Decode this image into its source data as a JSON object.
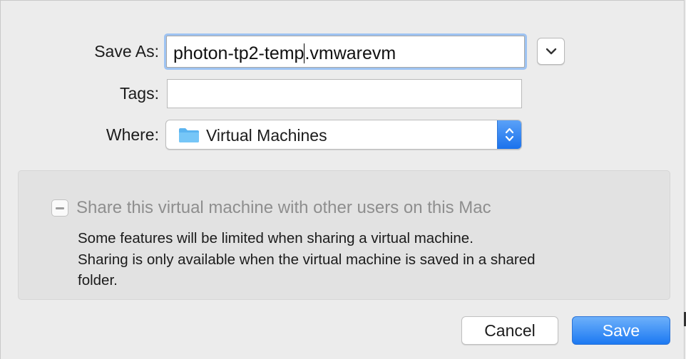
{
  "dialog": {
    "save_as_label": "Save As:",
    "filename_before_caret": "photon-tp2-temp",
    "filename_after_caret": ".vmwarevm",
    "tags_label": "Tags:",
    "tags_value": "",
    "where_label": "Where:",
    "where_value": "Virtual Machines",
    "where_icon": "folder-icon",
    "expand_icon": "chevron-down-icon",
    "stepper_icon": "up-down-arrows-icon"
  },
  "sharing": {
    "checkbox_state": "mixed",
    "checkbox_label": "Share this virtual machine with other users on this Mac",
    "note_line1": "Some features will be limited when sharing a virtual machine.",
    "note_line2": "Sharing is only available when the virtual machine is saved in a shared",
    "note_line3": "folder."
  },
  "buttons": {
    "cancel_label": "Cancel",
    "save_label": "Save"
  },
  "colors": {
    "accent": "#1c79f2",
    "focus_ring": "#9ec3f2",
    "folder": "#5bb4f0"
  }
}
